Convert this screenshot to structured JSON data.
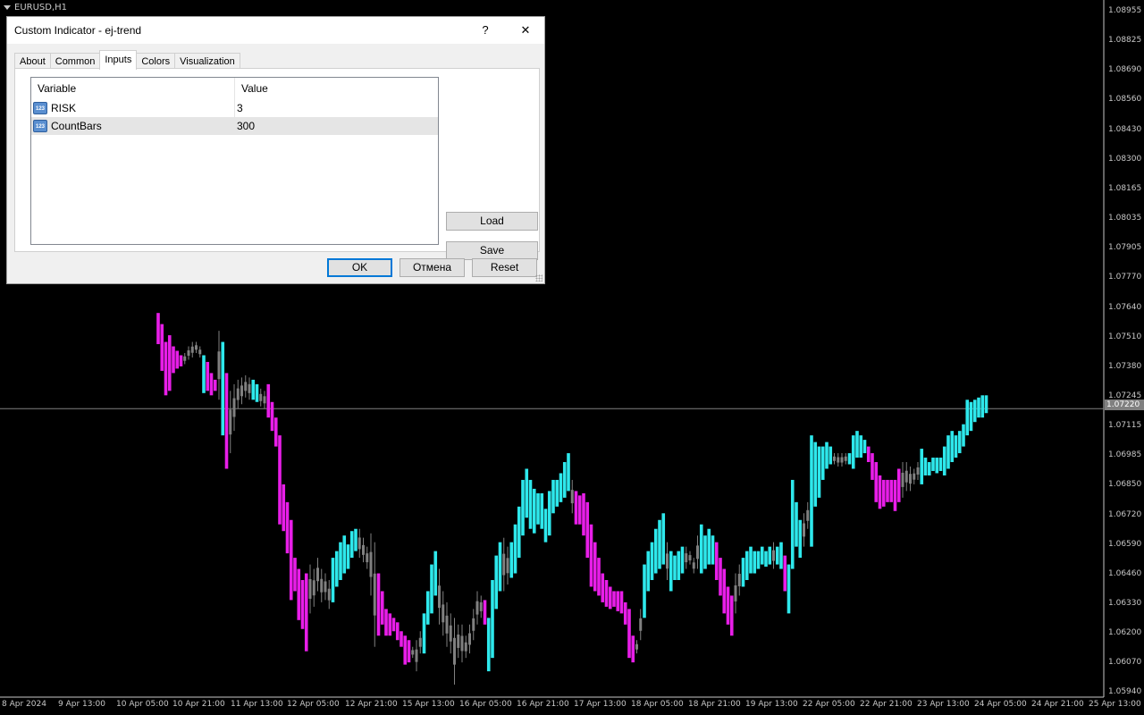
{
  "chart": {
    "symbol": "EURUSD,H1",
    "current_price": "1.07220",
    "y_labels": [
      "1.08955",
      "1.08825",
      "1.08690",
      "1.08560",
      "1.08430",
      "1.08300",
      "1.08165",
      "1.08035",
      "1.07905",
      "1.07770",
      "1.07640",
      "1.07510",
      "1.07380",
      "1.07245",
      "1.07115",
      "1.06985",
      "1.06850",
      "1.06720",
      "1.06590",
      "1.06460",
      "1.06330",
      "1.06200",
      "1.06070",
      "1.05940"
    ],
    "x_labels": [
      "8 Apr 2024",
      "9 Apr 13:00",
      "10 Apr 05:00",
      "10 Apr 21:00",
      "11 Apr 13:00",
      "12 Apr 05:00",
      "12 Apr 21:00",
      "15 Apr 13:00",
      "16 Apr 05:00",
      "16 Apr 21:00",
      "17 Apr 13:00",
      "18 Apr 05:00",
      "18 Apr 21:00",
      "19 Apr 13:00",
      "22 Apr 05:00",
      "22 Apr 21:00",
      "23 Apr 13:00",
      "24 Apr 05:00",
      "24 Apr 21:00",
      "25 Apr 13:00"
    ],
    "colors": {
      "up": "#2ee8ec",
      "down": "#e81ee8",
      "neutral": "#808080",
      "background": "#000000",
      "axis_text": "#c8c8c8"
    }
  },
  "chart_data": {
    "type": "bar",
    "symbol": "EURUSD",
    "timeframe": "H1",
    "y_unit": "price",
    "ylim": [
      1.0594,
      1.09
    ],
    "current_price": 1.0722,
    "grid": false,
    "legend": "none",
    "bars": [
      {
        "h": 1.0765,
        "l": 1.0751,
        "c": "down"
      },
      {
        "h": 1.076,
        "l": 1.0739,
        "c": "down"
      },
      {
        "h": 1.0752,
        "l": 1.0728,
        "c": "down"
      },
      {
        "h": 1.0755,
        "l": 1.073,
        "c": "down"
      },
      {
        "h": 1.075,
        "l": 1.0738,
        "c": "down"
      },
      {
        "h": 1.0748,
        "l": 1.074,
        "c": "down"
      },
      {
        "h": 1.0746,
        "l": 1.0741,
        "c": "down"
      },
      {
        "h": 1.0747,
        "l": 1.0742,
        "c": "neutral"
      },
      {
        "h": 1.075,
        "l": 1.0744,
        "c": "neutral"
      },
      {
        "h": 1.0752,
        "l": 1.0745,
        "c": "neutral"
      },
      {
        "h": 1.0752,
        "l": 1.0747,
        "c": "neutral"
      },
      {
        "h": 1.075,
        "l": 1.0745,
        "c": "neutral"
      },
      {
        "h": 1.0746,
        "l": 1.0729,
        "c": "up"
      },
      {
        "h": 1.0743,
        "l": 1.073,
        "c": "down"
      },
      {
        "h": 1.0738,
        "l": 1.0728,
        "c": "down"
      },
      {
        "h": 1.0735,
        "l": 1.073,
        "c": "down"
      },
      {
        "h": 1.0757,
        "l": 1.0726,
        "c": "neutral"
      },
      {
        "h": 1.0752,
        "l": 1.071,
        "c": "up"
      },
      {
        "h": 1.0738,
        "l": 1.0695,
        "c": "down"
      },
      {
        "h": 1.073,
        "l": 1.0702,
        "c": "neutral"
      },
      {
        "h": 1.0733,
        "l": 1.0712,
        "c": "neutral"
      },
      {
        "h": 1.0735,
        "l": 1.0722,
        "c": "neutral"
      },
      {
        "h": 1.0736,
        "l": 1.0724,
        "c": "neutral"
      },
      {
        "h": 1.0737,
        "l": 1.0727,
        "c": "neutral"
      },
      {
        "h": 1.0736,
        "l": 1.0726,
        "c": "neutral"
      },
      {
        "h": 1.0735,
        "l": 1.0726,
        "c": "up"
      },
      {
        "h": 1.0733,
        "l": 1.0725,
        "c": "up"
      },
      {
        "h": 1.0731,
        "l": 1.0723,
        "c": "neutral"
      },
      {
        "h": 1.073,
        "l": 1.0722,
        "c": "neutral"
      },
      {
        "h": 1.0733,
        "l": 1.0718,
        "c": "down"
      },
      {
        "h": 1.0725,
        "l": 1.0712,
        "c": "down"
      },
      {
        "h": 1.0718,
        "l": 1.0705,
        "c": "down"
      },
      {
        "h": 1.071,
        "l": 1.067,
        "c": "down"
      },
      {
        "h": 1.0688,
        "l": 1.0667,
        "c": "down"
      },
      {
        "h": 1.068,
        "l": 1.0657,
        "c": "down"
      },
      {
        "h": 1.0672,
        "l": 1.0636,
        "c": "down"
      },
      {
        "h": 1.0655,
        "l": 1.064,
        "c": "down"
      },
      {
        "h": 1.065,
        "l": 1.0627,
        "c": "down"
      },
      {
        "h": 1.0645,
        "l": 1.0623,
        "c": "down"
      },
      {
        "h": 1.0648,
        "l": 1.0613,
        "c": "down"
      },
      {
        "h": 1.0652,
        "l": 1.063,
        "c": "neutral"
      },
      {
        "h": 1.065,
        "l": 1.0633,
        "c": "neutral"
      },
      {
        "h": 1.0655,
        "l": 1.064,
        "c": "neutral"
      },
      {
        "h": 1.065,
        "l": 1.0635,
        "c": "neutral"
      },
      {
        "h": 1.0648,
        "l": 1.0636,
        "c": "neutral"
      },
      {
        "h": 1.0645,
        "l": 1.0632,
        "c": "neutral"
      },
      {
        "h": 1.0655,
        "l": 1.0635,
        "c": "up"
      },
      {
        "h": 1.0658,
        "l": 1.0642,
        "c": "up"
      },
      {
        "h": 1.0662,
        "l": 1.0645,
        "c": "up"
      },
      {
        "h": 1.0665,
        "l": 1.0648,
        "c": "up"
      },
      {
        "h": 1.0661,
        "l": 1.065,
        "c": "up"
      },
      {
        "h": 1.0667,
        "l": 1.0655,
        "c": "up"
      },
      {
        "h": 1.0668,
        "l": 1.0658,
        "c": "up"
      },
      {
        "h": 1.0668,
        "l": 1.0655,
        "c": "neutral"
      },
      {
        "h": 1.0664,
        "l": 1.0653,
        "c": "neutral"
      },
      {
        "h": 1.066,
        "l": 1.065,
        "c": "neutral"
      },
      {
        "h": 1.0666,
        "l": 1.0638,
        "c": "neutral"
      },
      {
        "h": 1.0662,
        "l": 1.0615,
        "c": "neutral"
      },
      {
        "h": 1.0648,
        "l": 1.062,
        "c": "down"
      },
      {
        "h": 1.064,
        "l": 1.0625,
        "c": "down"
      },
      {
        "h": 1.0632,
        "l": 1.062,
        "c": "down"
      },
      {
        "h": 1.063,
        "l": 1.062,
        "c": "down"
      },
      {
        "h": 1.0628,
        "l": 1.0622,
        "c": "down"
      },
      {
        "h": 1.0626,
        "l": 1.0618,
        "c": "down"
      },
      {
        "h": 1.0622,
        "l": 1.0615,
        "c": "down"
      },
      {
        "h": 1.062,
        "l": 1.0607,
        "c": "down"
      },
      {
        "h": 1.0618,
        "l": 1.0608,
        "c": "down"
      },
      {
        "h": 1.0615,
        "l": 1.061,
        "c": "neutral"
      },
      {
        "h": 1.0618,
        "l": 1.0604,
        "c": "neutral"
      },
      {
        "h": 1.0622,
        "l": 1.0612,
        "c": "neutral"
      },
      {
        "h": 1.063,
        "l": 1.0612,
        "c": "up"
      },
      {
        "h": 1.064,
        "l": 1.0625,
        "c": "up"
      },
      {
        "h": 1.0652,
        "l": 1.063,
        "c": "up"
      },
      {
        "h": 1.0658,
        "l": 1.0638,
        "c": "up"
      },
      {
        "h": 1.065,
        "l": 1.0625,
        "c": "neutral"
      },
      {
        "h": 1.064,
        "l": 1.062,
        "c": "neutral"
      },
      {
        "h": 1.0635,
        "l": 1.0615,
        "c": "neutral"
      },
      {
        "h": 1.063,
        "l": 1.0612,
        "c": "neutral"
      },
      {
        "h": 1.0628,
        "l": 1.0598,
        "c": "neutral"
      },
      {
        "h": 1.0625,
        "l": 1.061,
        "c": "neutral"
      },
      {
        "h": 1.0625,
        "l": 1.0608,
        "c": "neutral"
      },
      {
        "h": 1.062,
        "l": 1.061,
        "c": "neutral"
      },
      {
        "h": 1.0625,
        "l": 1.0612,
        "c": "neutral"
      },
      {
        "h": 1.0632,
        "l": 1.0618,
        "c": "neutral"
      },
      {
        "h": 1.064,
        "l": 1.0625,
        "c": "neutral"
      },
      {
        "h": 1.0638,
        "l": 1.0628,
        "c": "neutral"
      },
      {
        "h": 1.0636,
        "l": 1.0625,
        "c": "down"
      },
      {
        "h": 1.0628,
        "l": 1.0604,
        "c": "up"
      },
      {
        "h": 1.0645,
        "l": 1.061,
        "c": "up"
      },
      {
        "h": 1.0656,
        "l": 1.0632,
        "c": "up"
      },
      {
        "h": 1.0662,
        "l": 1.064,
        "c": "up"
      },
      {
        "h": 1.0664,
        "l": 1.064,
        "c": "neutral"
      },
      {
        "h": 1.066,
        "l": 1.0643,
        "c": "neutral"
      },
      {
        "h": 1.0662,
        "l": 1.0646,
        "c": "up"
      },
      {
        "h": 1.067,
        "l": 1.0648,
        "c": "up"
      },
      {
        "h": 1.0678,
        "l": 1.0655,
        "c": "up"
      },
      {
        "h": 1.069,
        "l": 1.0665,
        "c": "up"
      },
      {
        "h": 1.0695,
        "l": 1.0673,
        "c": "up"
      },
      {
        "h": 1.069,
        "l": 1.0668,
        "c": "up"
      },
      {
        "h": 1.0686,
        "l": 1.0666,
        "c": "up"
      },
      {
        "h": 1.0684,
        "l": 1.067,
        "c": "up"
      },
      {
        "h": 1.0684,
        "l": 1.0668,
        "c": "up"
      },
      {
        "h": 1.0677,
        "l": 1.0662,
        "c": "up"
      },
      {
        "h": 1.0685,
        "l": 1.0665,
        "c": "up"
      },
      {
        "h": 1.069,
        "l": 1.0675,
        "c": "up"
      },
      {
        "h": 1.069,
        "l": 1.0678,
        "c": "up"
      },
      {
        "h": 1.0693,
        "l": 1.068,
        "c": "up"
      },
      {
        "h": 1.0698,
        "l": 1.0682,
        "c": "up"
      },
      {
        "h": 1.0702,
        "l": 1.0685,
        "c": "up"
      },
      {
        "h": 1.069,
        "l": 1.0675,
        "c": "neutral"
      },
      {
        "h": 1.0685,
        "l": 1.067,
        "c": "down"
      },
      {
        "h": 1.0683,
        "l": 1.067,
        "c": "down"
      },
      {
        "h": 1.0684,
        "l": 1.0665,
        "c": "down"
      },
      {
        "h": 1.068,
        "l": 1.0655,
        "c": "down"
      },
      {
        "h": 1.067,
        "l": 1.0642,
        "c": "down"
      },
      {
        "h": 1.0662,
        "l": 1.064,
        "c": "down"
      },
      {
        "h": 1.0655,
        "l": 1.0638,
        "c": "down"
      },
      {
        "h": 1.0648,
        "l": 1.0635,
        "c": "down"
      },
      {
        "h": 1.0645,
        "l": 1.0633,
        "c": "down"
      },
      {
        "h": 1.0642,
        "l": 1.0632,
        "c": "down"
      },
      {
        "h": 1.064,
        "l": 1.0633,
        "c": "down"
      },
      {
        "h": 1.064,
        "l": 1.0631,
        "c": "down"
      },
      {
        "h": 1.064,
        "l": 1.063,
        "c": "down"
      },
      {
        "h": 1.0635,
        "l": 1.0625,
        "c": "down"
      },
      {
        "h": 1.0632,
        "l": 1.061,
        "c": "down"
      },
      {
        "h": 1.062,
        "l": 1.0608,
        "c": "down"
      },
      {
        "h": 1.0618,
        "l": 1.0612,
        "c": "neutral"
      },
      {
        "h": 1.0632,
        "l": 1.0618,
        "c": "neutral"
      },
      {
        "h": 1.0652,
        "l": 1.0628,
        "c": "up"
      },
      {
        "h": 1.0658,
        "l": 1.064,
        "c": "up"
      },
      {
        "h": 1.0662,
        "l": 1.0645,
        "c": "up"
      },
      {
        "h": 1.0668,
        "l": 1.0648,
        "c": "up"
      },
      {
        "h": 1.0672,
        "l": 1.065,
        "c": "up"
      },
      {
        "h": 1.0675,
        "l": 1.0652,
        "c": "up"
      },
      {
        "h": 1.0662,
        "l": 1.0645,
        "c": "neutral"
      },
      {
        "h": 1.0658,
        "l": 1.064,
        "c": "up"
      },
      {
        "h": 1.0656,
        "l": 1.0645,
        "c": "up"
      },
      {
        "h": 1.0658,
        "l": 1.0645,
        "c": "up"
      },
      {
        "h": 1.066,
        "l": 1.0648,
        "c": "up"
      },
      {
        "h": 1.066,
        "l": 1.065,
        "c": "neutral"
      },
      {
        "h": 1.0658,
        "l": 1.0652,
        "c": "neutral"
      },
      {
        "h": 1.0655,
        "l": 1.0648,
        "c": "neutral"
      },
      {
        "h": 1.0665,
        "l": 1.065,
        "c": "neutral"
      },
      {
        "h": 1.067,
        "l": 1.0648,
        "c": "up"
      },
      {
        "h": 1.0665,
        "l": 1.065,
        "c": "up"
      },
      {
        "h": 1.0668,
        "l": 1.0652,
        "c": "up"
      },
      {
        "h": 1.0665,
        "l": 1.0652,
        "c": "up"
      },
      {
        "h": 1.0662,
        "l": 1.0645,
        "c": "down"
      },
      {
        "h": 1.0655,
        "l": 1.0638,
        "c": "down"
      },
      {
        "h": 1.065,
        "l": 1.063,
        "c": "down"
      },
      {
        "h": 1.0642,
        "l": 1.0625,
        "c": "down"
      },
      {
        "h": 1.0638,
        "l": 1.062,
        "c": "down"
      },
      {
        "h": 1.0648,
        "l": 1.063,
        "c": "neutral"
      },
      {
        "h": 1.0652,
        "l": 1.0638,
        "c": "neutral"
      },
      {
        "h": 1.0655,
        "l": 1.0642,
        "c": "up"
      },
      {
        "h": 1.0658,
        "l": 1.0645,
        "c": "up"
      },
      {
        "h": 1.066,
        "l": 1.0648,
        "c": "up"
      },
      {
        "h": 1.0658,
        "l": 1.0648,
        "c": "up"
      },
      {
        "h": 1.0658,
        "l": 1.065,
        "c": "up"
      },
      {
        "h": 1.066,
        "l": 1.0652,
        "c": "up"
      },
      {
        "h": 1.0658,
        "l": 1.0651,
        "c": "up"
      },
      {
        "h": 1.066,
        "l": 1.0652,
        "c": "up"
      },
      {
        "h": 1.0662,
        "l": 1.065,
        "c": "neutral"
      },
      {
        "h": 1.066,
        "l": 1.0652,
        "c": "up"
      },
      {
        "h": 1.0662,
        "l": 1.065,
        "c": "up"
      },
      {
        "h": 1.0656,
        "l": 1.064,
        "c": "down"
      },
      {
        "h": 1.0652,
        "l": 1.063,
        "c": "up"
      },
      {
        "h": 1.069,
        "l": 1.065,
        "c": "up"
      },
      {
        "h": 1.068,
        "l": 1.066,
        "c": "up"
      },
      {
        "h": 1.0672,
        "l": 1.0655,
        "c": "up"
      },
      {
        "h": 1.0675,
        "l": 1.066,
        "c": "neutral"
      },
      {
        "h": 1.068,
        "l": 1.0668,
        "c": "neutral"
      },
      {
        "h": 1.071,
        "l": 1.066,
        "c": "up"
      },
      {
        "h": 1.0707,
        "l": 1.0678,
        "c": "up"
      },
      {
        "h": 1.0705,
        "l": 1.0682,
        "c": "up"
      },
      {
        "h": 1.0705,
        "l": 1.069,
        "c": "up"
      },
      {
        "h": 1.0707,
        "l": 1.0695,
        "c": "up"
      },
      {
        "h": 1.0705,
        "l": 1.0697,
        "c": "up"
      },
      {
        "h": 1.0702,
        "l": 1.0697,
        "c": "neutral"
      },
      {
        "h": 1.0702,
        "l": 1.0696,
        "c": "neutral"
      },
      {
        "h": 1.0702,
        "l": 1.0696,
        "c": "neutral"
      },
      {
        "h": 1.0702,
        "l": 1.0697,
        "c": "neutral"
      },
      {
        "h": 1.0702,
        "l": 1.0697,
        "c": "up"
      },
      {
        "h": 1.071,
        "l": 1.0695,
        "c": "up"
      },
      {
        "h": 1.0712,
        "l": 1.07,
        "c": "up"
      },
      {
        "h": 1.071,
        "l": 1.07,
        "c": "up"
      },
      {
        "h": 1.0708,
        "l": 1.0702,
        "c": "up"
      },
      {
        "h": 1.0705,
        "l": 1.0698,
        "c": "down"
      },
      {
        "h": 1.0702,
        "l": 1.069,
        "c": "down"
      },
      {
        "h": 1.0698,
        "l": 1.068,
        "c": "down"
      },
      {
        "h": 1.0692,
        "l": 1.0677,
        "c": "down"
      },
      {
        "h": 1.069,
        "l": 1.0678,
        "c": "down"
      },
      {
        "h": 1.069,
        "l": 1.068,
        "c": "down"
      },
      {
        "h": 1.069,
        "l": 1.068,
        "c": "down"
      },
      {
        "h": 1.069,
        "l": 1.0676,
        "c": "down"
      },
      {
        "h": 1.0695,
        "l": 1.068,
        "c": "down"
      },
      {
        "h": 1.0698,
        "l": 1.0682,
        "c": "neutral"
      },
      {
        "h": 1.0698,
        "l": 1.0685,
        "c": "neutral"
      },
      {
        "h": 1.0696,
        "l": 1.0685,
        "c": "neutral"
      },
      {
        "h": 1.0695,
        "l": 1.0688,
        "c": "neutral"
      },
      {
        "h": 1.0698,
        "l": 1.069,
        "c": "neutral"
      },
      {
        "h": 1.0704,
        "l": 1.0688,
        "c": "up"
      },
      {
        "h": 1.07,
        "l": 1.0692,
        "c": "up"
      },
      {
        "h": 1.0698,
        "l": 1.0692,
        "c": "up"
      },
      {
        "h": 1.07,
        "l": 1.0694,
        "c": "up"
      },
      {
        "h": 1.07,
        "l": 1.0693,
        "c": "up"
      },
      {
        "h": 1.07,
        "l": 1.0694,
        "c": "up"
      },
      {
        "h": 1.0705,
        "l": 1.0692,
        "c": "up"
      },
      {
        "h": 1.071,
        "l": 1.0695,
        "c": "up"
      },
      {
        "h": 1.0712,
        "l": 1.0698,
        "c": "up"
      },
      {
        "h": 1.071,
        "l": 1.07,
        "c": "up"
      },
      {
        "h": 1.0712,
        "l": 1.0702,
        "c": "up"
      },
      {
        "h": 1.0715,
        "l": 1.0705,
        "c": "up"
      },
      {
        "h": 1.0726,
        "l": 1.071,
        "c": "up"
      },
      {
        "h": 1.0725,
        "l": 1.0712,
        "c": "up"
      },
      {
        "h": 1.0726,
        "l": 1.0716,
        "c": "up"
      },
      {
        "h": 1.0727,
        "l": 1.0718,
        "c": "up"
      },
      {
        "h": 1.0728,
        "l": 1.0718,
        "c": "up"
      },
      {
        "h": 1.0728,
        "l": 1.072,
        "c": "up"
      }
    ]
  },
  "dialog": {
    "title": "Custom Indicator - ej-trend",
    "help": "?",
    "close": "✕",
    "tabs": [
      "About",
      "Common",
      "Inputs",
      "Colors",
      "Visualization"
    ],
    "active_tab": "Inputs",
    "table": {
      "headers": [
        "Variable",
        "Value"
      ],
      "rows": [
        {
          "icon": "123",
          "variable": "RISK",
          "value": "3"
        },
        {
          "icon": "123",
          "variable": "CountBars",
          "value": "300"
        }
      ]
    },
    "load": "Load",
    "save": "Save",
    "ok": "OK",
    "cancel": "Отмена",
    "reset": "Reset"
  }
}
